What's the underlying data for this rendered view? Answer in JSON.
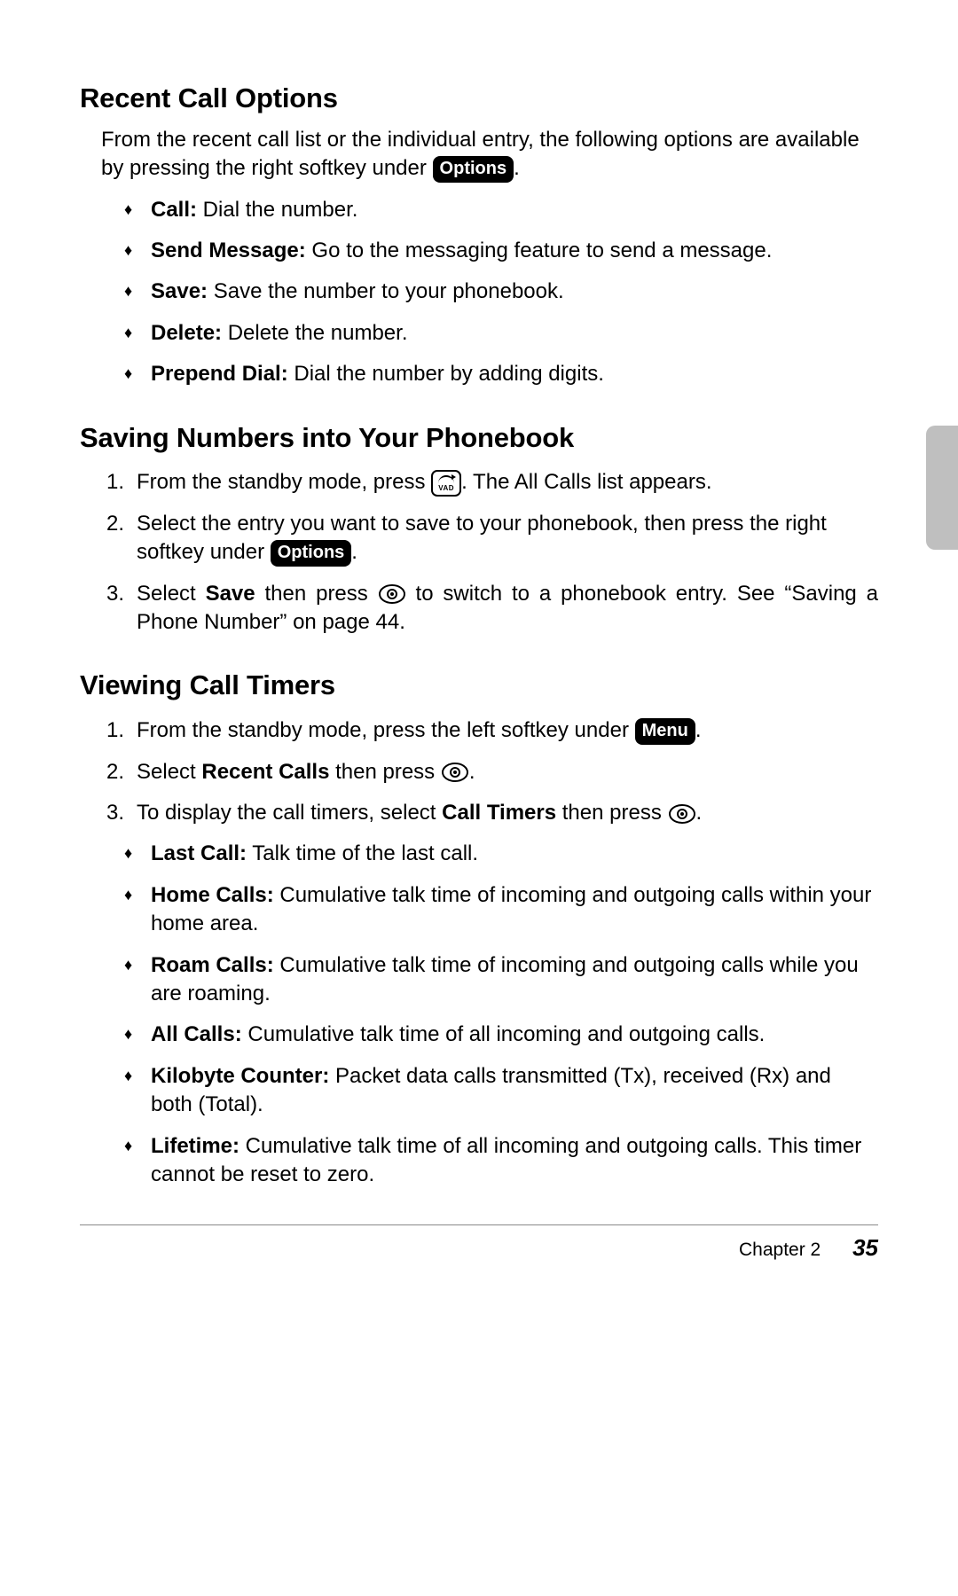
{
  "sections": {
    "recent": {
      "title": "Recent Call Options",
      "intro_a": "From the recent call list or the individual entry, the following options are available by pressing the right softkey under ",
      "intro_badge": "Options",
      "intro_b": ".",
      "bullets": [
        {
          "term": "Call:",
          "desc": " Dial the number."
        },
        {
          "term": "Send Message:",
          "desc": " Go to the messaging feature to send a message."
        },
        {
          "term": "Save:",
          "desc": " Save the number to your phonebook."
        },
        {
          "term": "Delete:",
          "desc": " Delete the number."
        },
        {
          "term": "Prepend Dial:",
          "desc": " Dial the number by adding digits."
        }
      ]
    },
    "saving": {
      "title": "Saving Numbers into Your Phonebook",
      "steps": {
        "s1a": "From the standby mode, press ",
        "s1b": ". The All Calls list appears.",
        "s2a": "Select the entry you want to save to your phonebook, then press the right softkey under ",
        "s2badge": "Options",
        "s2b": ".",
        "s3a": "Select ",
        "s3bold": "Save",
        "s3b": " then press ",
        "s3c": " to switch to a phonebook entry. See “Saving a Phone Number” on page 44."
      }
    },
    "timers": {
      "title": "Viewing Call Timers",
      "steps": {
        "s1a": "From the standby mode, press the left softkey under ",
        "s1badge": "Menu",
        "s1b": ".",
        "s2a": "Select ",
        "s2bold": "Recent Calls",
        "s2b": " then press ",
        "s2c": ".",
        "s3a": "To display the call timers, select ",
        "s3bold": "Call Timers",
        "s3b": " then press ",
        "s3c": "."
      },
      "bullets": [
        {
          "term": "Last Call:",
          "desc": " Talk time of the last call."
        },
        {
          "term": "Home Calls:",
          "desc": " Cumulative talk time of incoming and outgoing calls within your home area."
        },
        {
          "term": "Roam Calls:",
          "desc": " Cumulative talk time of incoming and outgoing calls while you are roaming."
        },
        {
          "term": "All Calls:",
          "desc": " Cumulative talk time of all incoming and outgoing calls."
        },
        {
          "term": "Kilobyte Counter:",
          "desc": " Packet data calls transmitted (Tx), received (Rx) and both (Total)."
        },
        {
          "term": "Lifetime:",
          "desc": " Cumulative talk time of all incoming and outgoing calls. This timer cannot be reset to zero."
        }
      ]
    }
  },
  "key_label": "VAD",
  "footer": {
    "chapter": "Chapter 2",
    "page": "35"
  }
}
